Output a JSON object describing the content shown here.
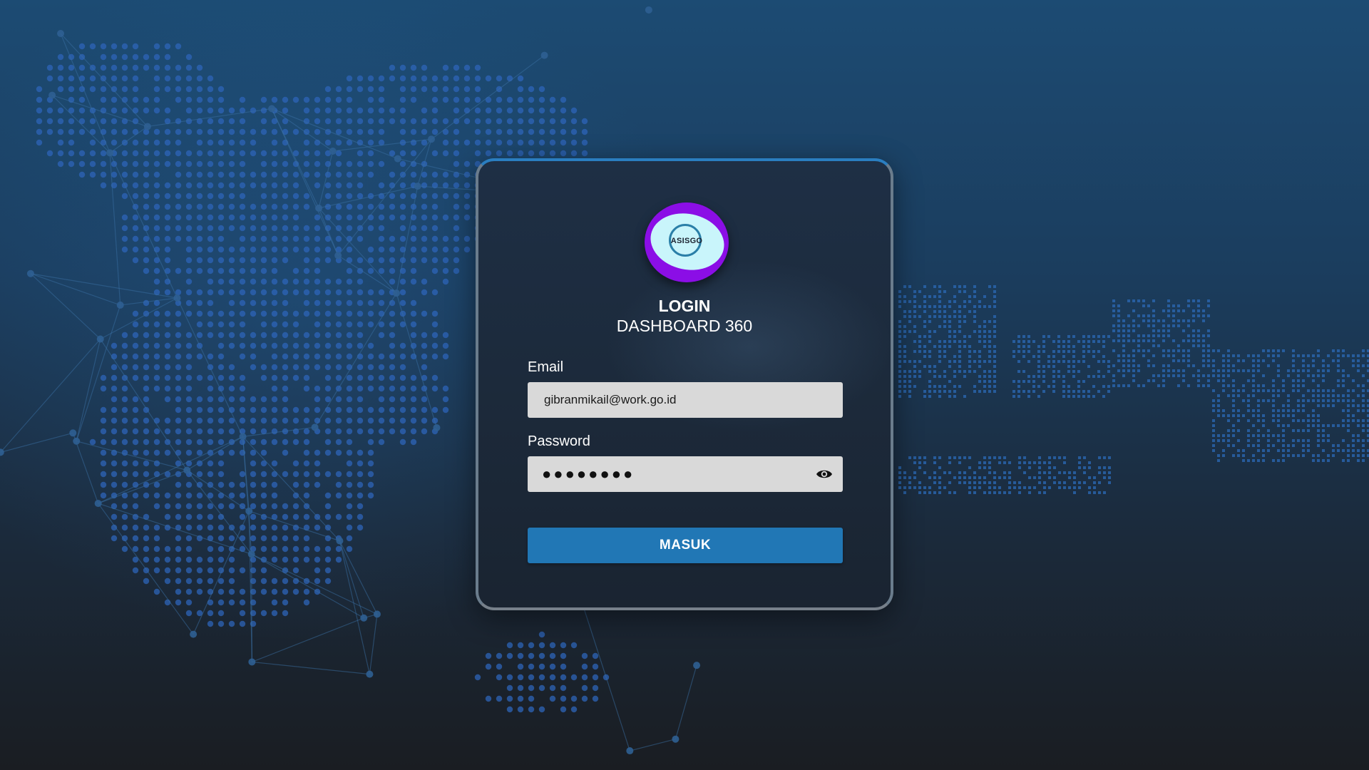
{
  "logo": {
    "text": "ASISGO",
    "colors": {
      "outer": "#8b0ee6",
      "inner": "#c9f5fb"
    }
  },
  "login": {
    "title": "LOGIN",
    "subtitle": "DASHBOARD 360",
    "email_label": "Email",
    "email_value": "gibranmikail@work.go.id",
    "password_label": "Password",
    "password_masked": "●●●●●●●●",
    "show_password_icon": "eye-icon",
    "submit_label": "MASUK"
  },
  "colors": {
    "accent": "#2177b5",
    "field_bg": "#d9d9d9",
    "card_bg": "#1c2a3b"
  }
}
